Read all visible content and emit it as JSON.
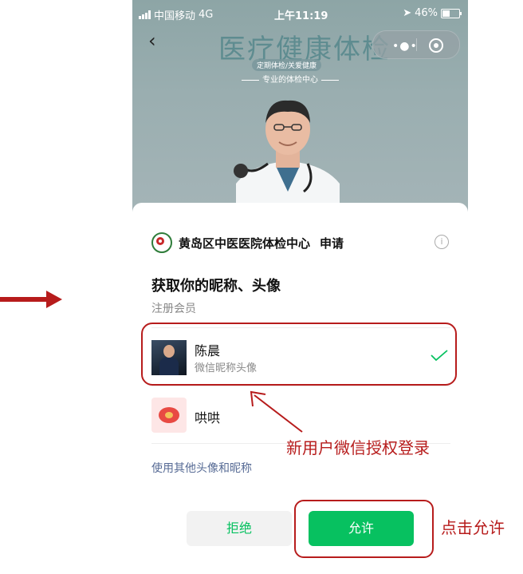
{
  "status_bar": {
    "carrier": "中国移动",
    "network": "4G",
    "time": "上午11:19",
    "battery": "46%"
  },
  "banner": {
    "title": "医疗健康体检",
    "subtitle": "定期体检/关爱健康",
    "tagline": "专业的体检中心"
  },
  "dialog": {
    "app_name": "黄岛区中医医院体检中心",
    "apply_label": "申请",
    "request_title": "获取你的昵称、头像",
    "request_subtitle": "注册会员",
    "options": [
      {
        "name": "陈晨",
        "desc": "微信昵称头像",
        "selected": true
      },
      {
        "name": "哄哄",
        "desc": "",
        "selected": false
      }
    ],
    "other_link": "使用其他头像和昵称",
    "deny_label": "拒绝",
    "allow_label": "允许"
  },
  "annotations": {
    "new_user_note": "新用户微信授权登录",
    "click_allow_note": "点击允许"
  },
  "colors": {
    "wechat_green": "#07c160",
    "annotation_red": "#b71c1c",
    "link_blue": "#576b95"
  }
}
